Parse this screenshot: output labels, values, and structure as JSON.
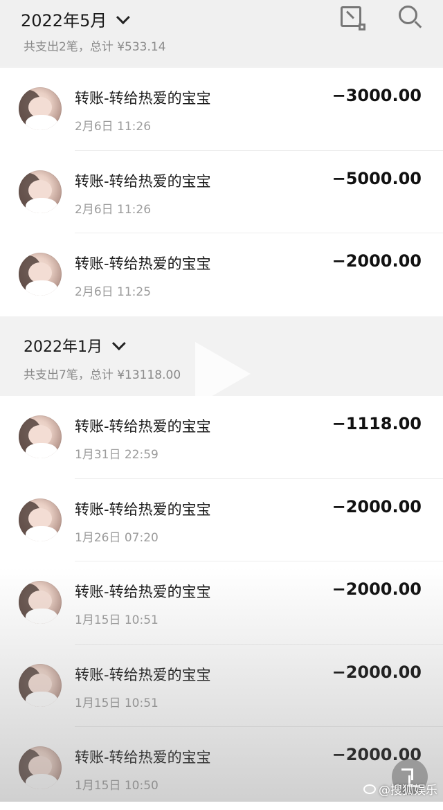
{
  "header": {
    "month": "2022年5月",
    "summary": "共支出2笔，总计 ¥533.14"
  },
  "section1": {
    "rows": [
      {
        "name": "转账-转给热爱的宝宝",
        "time": "2月6日 11:26",
        "amount": "−3000.00"
      },
      {
        "name": "转账-转给热爱的宝宝",
        "time": "2月6日 11:26",
        "amount": "−5000.00"
      },
      {
        "name": "转账-转给热爱的宝宝",
        "time": "2月6日 11:25",
        "amount": "−2000.00"
      }
    ]
  },
  "section2": {
    "month": "2022年1月",
    "summary": "共支出7笔，总计 ¥13118.00",
    "rows": [
      {
        "name": "转账-转给热爱的宝宝",
        "time": "1月31日 22:59",
        "amount": "−1118.00"
      },
      {
        "name": "转账-转给热爱的宝宝",
        "time": "1月26日 07:20",
        "amount": "−2000.00"
      },
      {
        "name": "转账-转给热爱的宝宝",
        "time": "1月15日 10:51",
        "amount": "−2000.00"
      },
      {
        "name": "转账-转给热爱的宝宝",
        "time": "1月15日 10:51",
        "amount": "−2000.00"
      },
      {
        "name": "转账-转给热爱的宝宝",
        "time": "1月15日 10:50",
        "amount": "−2000.00"
      }
    ]
  },
  "watermark": "@搜狐娱乐",
  "icons": {
    "export": "export-icon",
    "search": "search-icon",
    "play": "play-icon",
    "fullscreen": "fullscreen-icon",
    "dropdown": "chevron-down-icon"
  }
}
